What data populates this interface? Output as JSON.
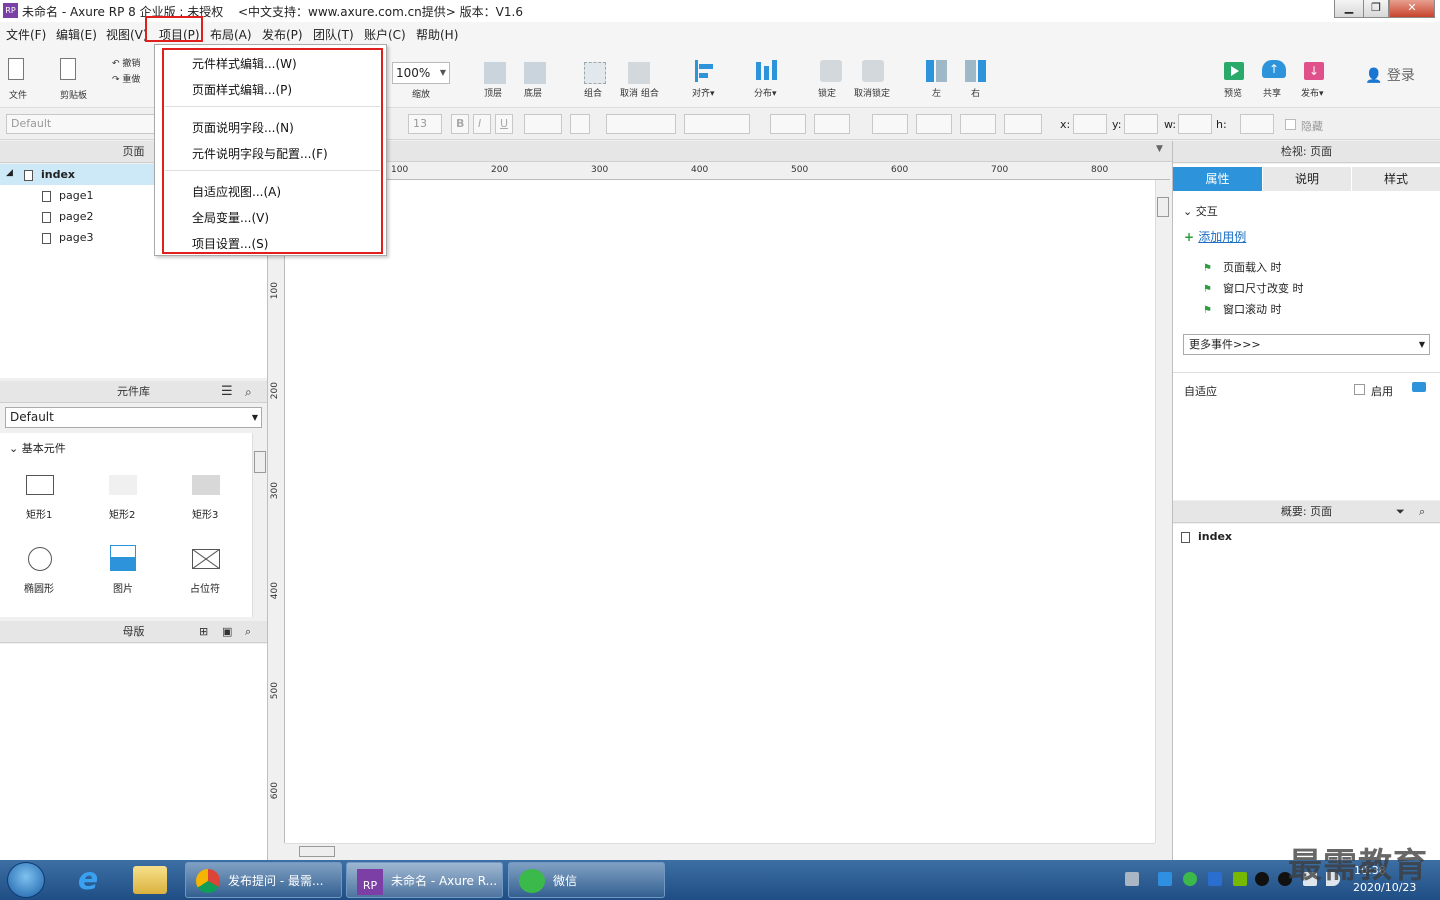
{
  "window": {
    "title": "未命名 - Axure RP 8 企业版 : 未授权",
    "title_extra": "<中文支持：www.axure.com.cn提供> 版本：V1.6",
    "app_icon_text": "RP",
    "min_label": "▁",
    "max_label": "❐",
    "close_label": "✕"
  },
  "menubar": {
    "items": [
      "文件(F)",
      "编辑(E)",
      "视图(V)",
      "项目(P)",
      "布局(A)",
      "发布(P)",
      "团队(T)",
      "账户(C)",
      "帮助(H)"
    ]
  },
  "toolbar": {
    "file": "文件",
    "clipboard": "剪贴板",
    "undo": "撤销",
    "redo": "重做",
    "zoom_value": "100%",
    "zoom": "缩放",
    "top": "顶层",
    "bottom": "底层",
    "group": "组合",
    "ungroup": "取消 组合",
    "align": "对齐▾",
    "distribute": "分布▾",
    "lock": "锁定",
    "unlock": "取消锁定",
    "left": "左",
    "right": "右",
    "preview": "预览",
    "share": "共享",
    "publish": "发布▾",
    "login": "登录"
  },
  "formatbar": {
    "style": "Default",
    "font_size": "13",
    "bold": "B",
    "italic": "I",
    "underline": "U",
    "x": "x:",
    "y": "y:",
    "w": "w:",
    "h": "h:",
    "hide": "隐藏"
  },
  "project_menu": {
    "items": [
      "元件样式编辑...(W)",
      "页面样式编辑...(P)",
      "页面说明字段...(N)",
      "元件说明字段与配置...(F)",
      "自适应视图...(A)",
      "全局变量...(V)",
      "项目设置...(S)"
    ]
  },
  "pages_panel": {
    "title": "页面",
    "root": "index",
    "children": [
      "page1",
      "page2",
      "page3"
    ]
  },
  "library_panel": {
    "title": "元件库",
    "selected_library": "Default",
    "section": "基本元件",
    "widgets": [
      "矩形1",
      "矩形2",
      "矩形3",
      "椭圆形",
      "图片",
      "占位符"
    ]
  },
  "masters_panel": {
    "title": "母版"
  },
  "ruler": {
    "top": [
      "100",
      "200",
      "300",
      "400",
      "500",
      "600",
      "700",
      "800"
    ],
    "left": [
      "100",
      "200",
      "300",
      "400",
      "500",
      "600"
    ]
  },
  "inspector": {
    "title": "检视: 页面",
    "tabs": [
      "属性",
      "说明",
      "样式"
    ],
    "interaction": "交互",
    "add_case": "添加用例",
    "events": [
      "页面载入 时",
      "窗口尺寸改变 时",
      "窗口滚动 时"
    ],
    "more_events": "更多事件>>>",
    "adaptive": "自适应",
    "enable": "启用"
  },
  "outline_panel": {
    "title": "概要: 页面",
    "item": "index"
  },
  "taskbar": {
    "tasks": [
      "发布提问 - 最需...",
      "未命名 - Axure R...",
      "微信"
    ],
    "time": "10:38",
    "date": "2020/10/23",
    "watermark": "最需教育"
  },
  "colors": {
    "accent": "#2d94db",
    "highlight_red": "#e0201c",
    "selected_row": "#cde8f7",
    "axure_purple": "#7b3fa6",
    "add_link": "#1a6fc4"
  }
}
